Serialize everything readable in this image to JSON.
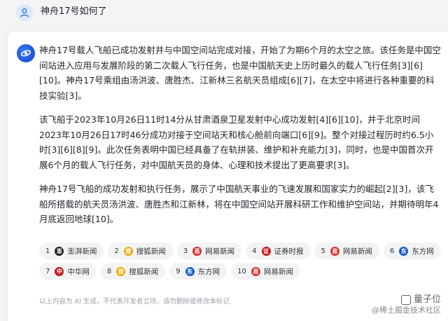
{
  "question": {
    "text": "神舟17号如何了"
  },
  "answer": {
    "paragraphs": [
      "神舟17号载人飞船已成功发射并与中国空间站完成对接，开始了为期6个月的太空之旅。该任务是中国空间站进入应用与发展阶段的第二次载人飞行任务，也是中国航天史上历时最久的载人飞行任务[3][6][10]。神舟17号乘组由汤洪波、唐胜杰、江新林三名航天员组成[6][7]，在太空中将进行各种重要的科技实验[3]。",
      "该飞船于2023年10月26日11时14分从甘肃酒泉卫星发射中心成功发射[4][6][10]，并于北京时间2023年10月26日17时46分成功对接于空间站天和核心舱前向端口[6][9]。整个对接过程历时约6.5小时[3][6][8][9]。此次任务表明中国已经具备了在轨拼装、维护和补充能力[3]，同时，也是中国首次开展6个月的载人飞行任务，对中国航天员的身体、心理和技术提出了更高要求[3]。",
      "神舟17号飞船的成功发射和执行任务，展示了中国航天事业的飞速发展和国家实力的崛起[2][3]，该飞船所搭载的航天员汤洪波、唐胜杰和江新林，将在中国空间站开展科研工作和维护空间站，并期待明年4月底返回地球[10]。"
    ]
  },
  "sources": [
    {
      "num": "1",
      "name": "澎湃新闻",
      "color": "#222222",
      "glyph": "澎"
    },
    {
      "num": "2",
      "name": "搜狐新闻",
      "color": "#f2a900",
      "glyph": "搜"
    },
    {
      "num": "3",
      "name": "网易新闻",
      "color": "#e0302d",
      "glyph": "易"
    },
    {
      "num": "4",
      "name": "证券时报",
      "color": "#c8161d",
      "glyph": "证"
    },
    {
      "num": "5",
      "name": "网易新闻",
      "color": "#e0302d",
      "glyph": "易"
    },
    {
      "num": "6",
      "name": "东方网",
      "color": "#1a5cc8",
      "glyph": "东"
    },
    {
      "num": "7",
      "name": "中华网",
      "color": "#c8161d",
      "glyph": "中"
    },
    {
      "num": "8",
      "name": "搜狐新闻",
      "color": "#f2a900",
      "glyph": "搜"
    },
    {
      "num": "9",
      "name": "东方网",
      "color": "#1a5cc8",
      "glyph": "东"
    },
    {
      "num": "10",
      "name": "网易新闻",
      "color": "#e0302d",
      "glyph": "易"
    }
  ],
  "disclaimer": "以上内容为 AI 生成，不代表开发者立场，请勿删除或修改本标记",
  "watermark": {
    "brand": "量子位",
    "sub": "@稀土掘金技术社区"
  }
}
